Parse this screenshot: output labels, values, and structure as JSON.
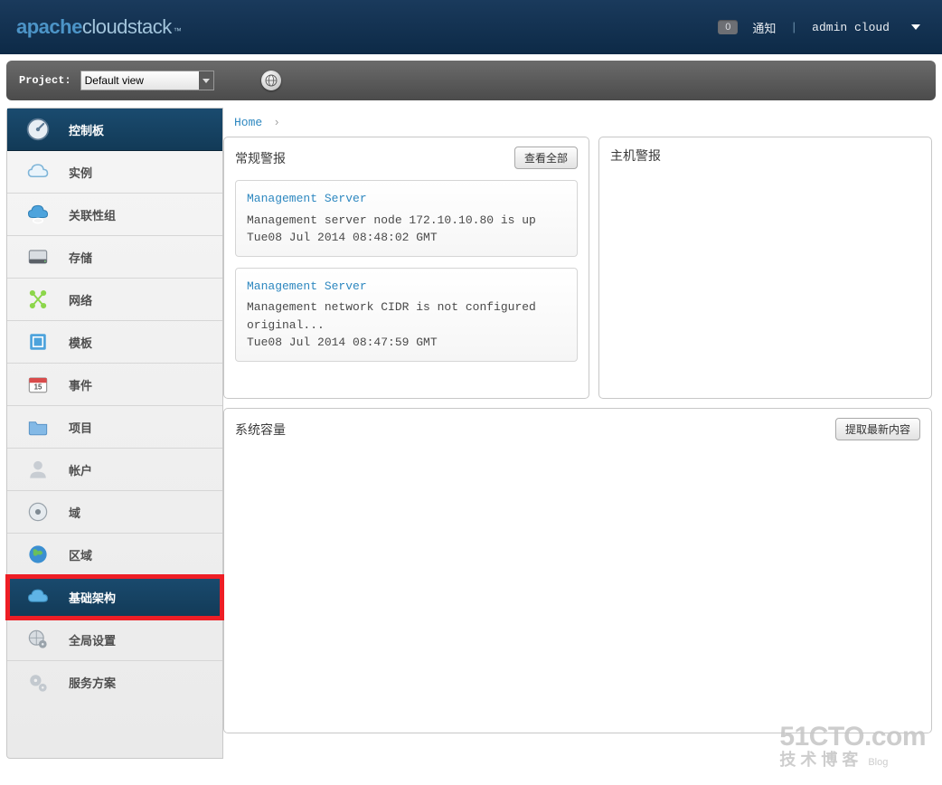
{
  "header": {
    "logo_bold": "apache",
    "logo_light": "cloudstack",
    "notif_count": "0",
    "notif_label": "通知",
    "user": "admin cloud"
  },
  "toolbar": {
    "project_label": "Project:",
    "project_value": "Default view"
  },
  "breadcrumb": {
    "home": "Home"
  },
  "sidebar": {
    "items": [
      {
        "label": "控制板"
      },
      {
        "label": "实例"
      },
      {
        "label": "关联性组"
      },
      {
        "label": "存储"
      },
      {
        "label": "网络"
      },
      {
        "label": "模板"
      },
      {
        "label": "事件"
      },
      {
        "label": "项目"
      },
      {
        "label": "帐户"
      },
      {
        "label": "域"
      },
      {
        "label": "区域"
      },
      {
        "label": "基础架构"
      },
      {
        "label": "全局设置"
      },
      {
        "label": "服务方案"
      }
    ]
  },
  "alerts": {
    "title": "常规警报",
    "view_all": "查看全部",
    "items": [
      {
        "title": "Management Server",
        "body": "Management server node 172.10.10.80 is up",
        "time": "Tue08 Jul 2014 08:48:02 GMT"
      },
      {
        "title": "Management Server",
        "body": "Management network CIDR is not configured original...",
        "time": "Tue08 Jul 2014 08:47:59 GMT"
      }
    ]
  },
  "host_alerts": {
    "title": "主机警报"
  },
  "capacity": {
    "title": "系统容量",
    "refresh": "提取最新内容"
  },
  "watermark": {
    "line1": "51CTO.com",
    "line2": "技术博客",
    "blog": "Blog"
  }
}
